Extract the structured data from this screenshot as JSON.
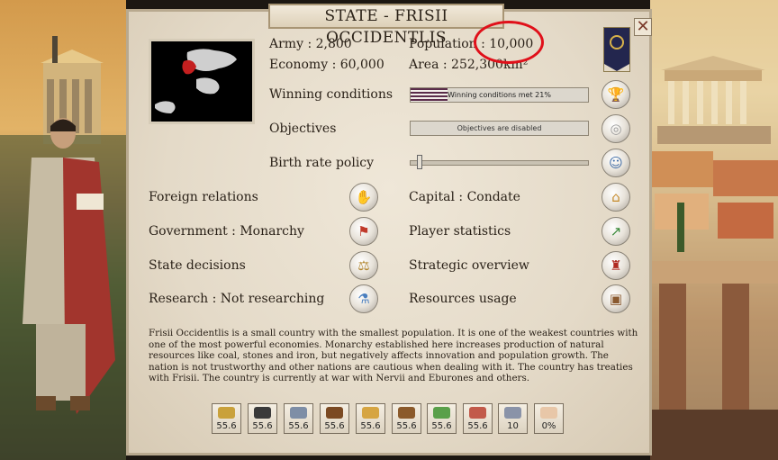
{
  "window": {
    "title": "STATE - FRISII OCCIDENTLIS",
    "close_glyph": "✕"
  },
  "stats": {
    "army": "Army : 2,800",
    "economy": "Economy : 60,000",
    "population": "Population : 10,000",
    "area": "Area : 252,300km²"
  },
  "rows": {
    "winning_conditions": {
      "label": "Winning conditions",
      "bar_text": "Winning conditions met 21%",
      "progress": 0.21,
      "icon": "trophy-icon"
    },
    "objectives": {
      "label": "Objectives",
      "bar_text": "Objectives are disabled",
      "icon": "scroll-icon"
    },
    "birth_rate": {
      "label": "Birth rate policy",
      "slider_value": 0.04,
      "icon": "person-icon"
    }
  },
  "actions_left": [
    {
      "label": "Foreign relations",
      "icon": "handshake-icon"
    },
    {
      "label": "Government : Monarchy",
      "icon": "banner-icon"
    },
    {
      "label": "State decisions",
      "icon": "scales-icon"
    },
    {
      "label": "Research : Not researching",
      "icon": "flask-icon"
    }
  ],
  "actions_right": [
    {
      "label": "Capital : Condate",
      "icon": "city-icon"
    },
    {
      "label": "Player statistics",
      "icon": "chart-icon"
    },
    {
      "label": "Strategic overview",
      "icon": "helmet-icon"
    },
    {
      "label": "Resources usage",
      "icon": "barrel-icon"
    }
  ],
  "description": "Frisii Occidentlis is a small country with the smallest population. It is one of the weakest countries with one of the most powerful economies. Monarchy established here increases production of natural resources like coal, stones and iron, but negatively affects innovation and population growth. The nation is not trustworthy and other nations are cautious when dealing with it. The country has treaties with Frisii. The country is currently at war with Nervii and Eburones and others.",
  "resources": [
    {
      "icon": "gold-icon",
      "value": "55.6",
      "color": "#c9a13b"
    },
    {
      "icon": "coal-icon",
      "value": "55.6",
      "color": "#3a3a3a"
    },
    {
      "icon": "iron-icon",
      "value": "55.6",
      "color": "#7e8ea6"
    },
    {
      "icon": "leather-icon",
      "value": "55.6",
      "color": "#7b4a23"
    },
    {
      "icon": "wheat-icon",
      "value": "55.6",
      "color": "#d6a542"
    },
    {
      "icon": "wood-icon",
      "value": "55.6",
      "color": "#8b5a2b"
    },
    {
      "icon": "herbs-icon",
      "value": "55.6",
      "color": "#5aa04a"
    },
    {
      "icon": "meat-icon",
      "value": "55.6",
      "color": "#c25a4a"
    },
    {
      "icon": "population-icon",
      "value": "10",
      "color": "#8a93a8"
    },
    {
      "icon": "happiness-icon",
      "value": "0%",
      "color": "#e8c7a8"
    }
  ],
  "colors": {
    "flag": "#23264e",
    "highlight": "#e0101a",
    "progress_fill": "#5a2c4a"
  }
}
